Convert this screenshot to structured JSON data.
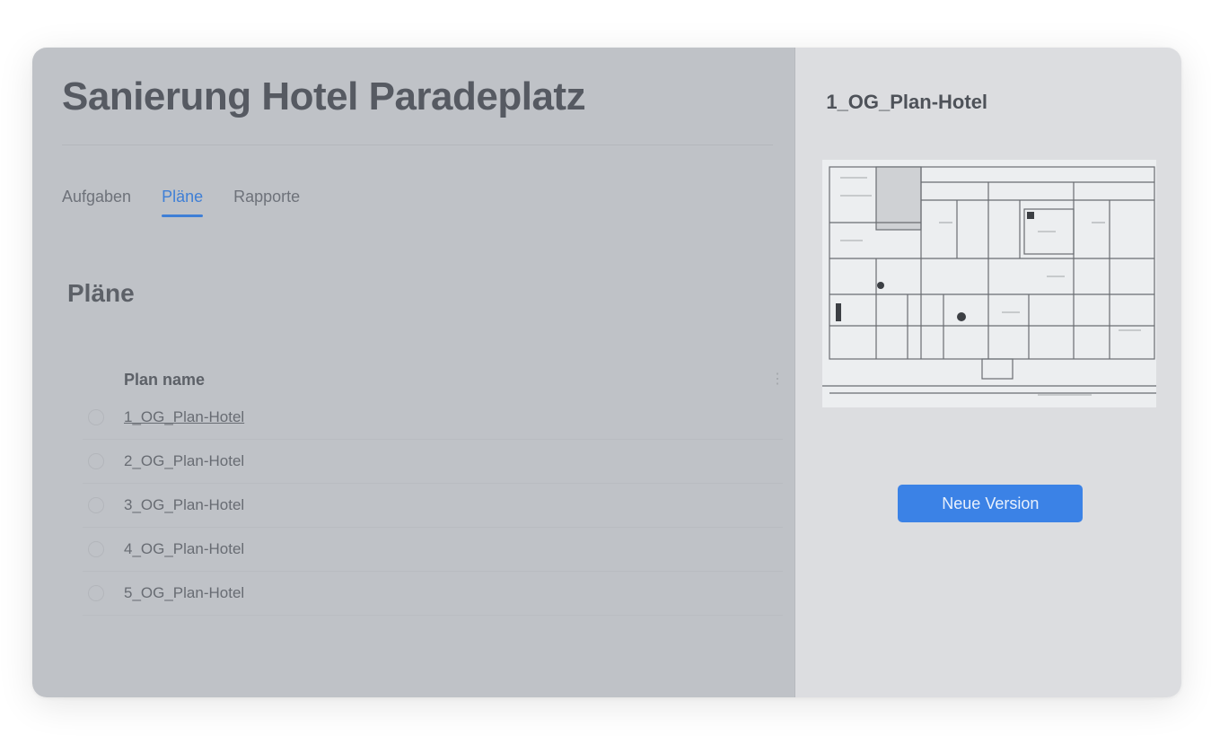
{
  "project": {
    "title": "Sanierung Hotel Paradeplatz"
  },
  "tabs": [
    {
      "label": "Aufgaben",
      "active": false
    },
    {
      "label": "Pläne",
      "active": true
    },
    {
      "label": "Rapporte",
      "active": false
    }
  ],
  "plans": {
    "section_title": "Pläne",
    "column_header": "Plan name",
    "rows": [
      {
        "name": "1_OG_Plan-Hotel",
        "selected": true
      },
      {
        "name": "2_OG_Plan-Hotel",
        "selected": false
      },
      {
        "name": "3_OG_Plan-Hotel",
        "selected": false
      },
      {
        "name": "4_OG_Plan-Hotel",
        "selected": false
      },
      {
        "name": "5_OG_Plan-Hotel",
        "selected": false
      }
    ]
  },
  "preview": {
    "title": "1_OG_Plan-Hotel",
    "new_version_label": "Neue Version"
  },
  "colors": {
    "accent": "#3b82e6",
    "main_background": "#bfc2c7",
    "side_background": "#dcdde0"
  }
}
